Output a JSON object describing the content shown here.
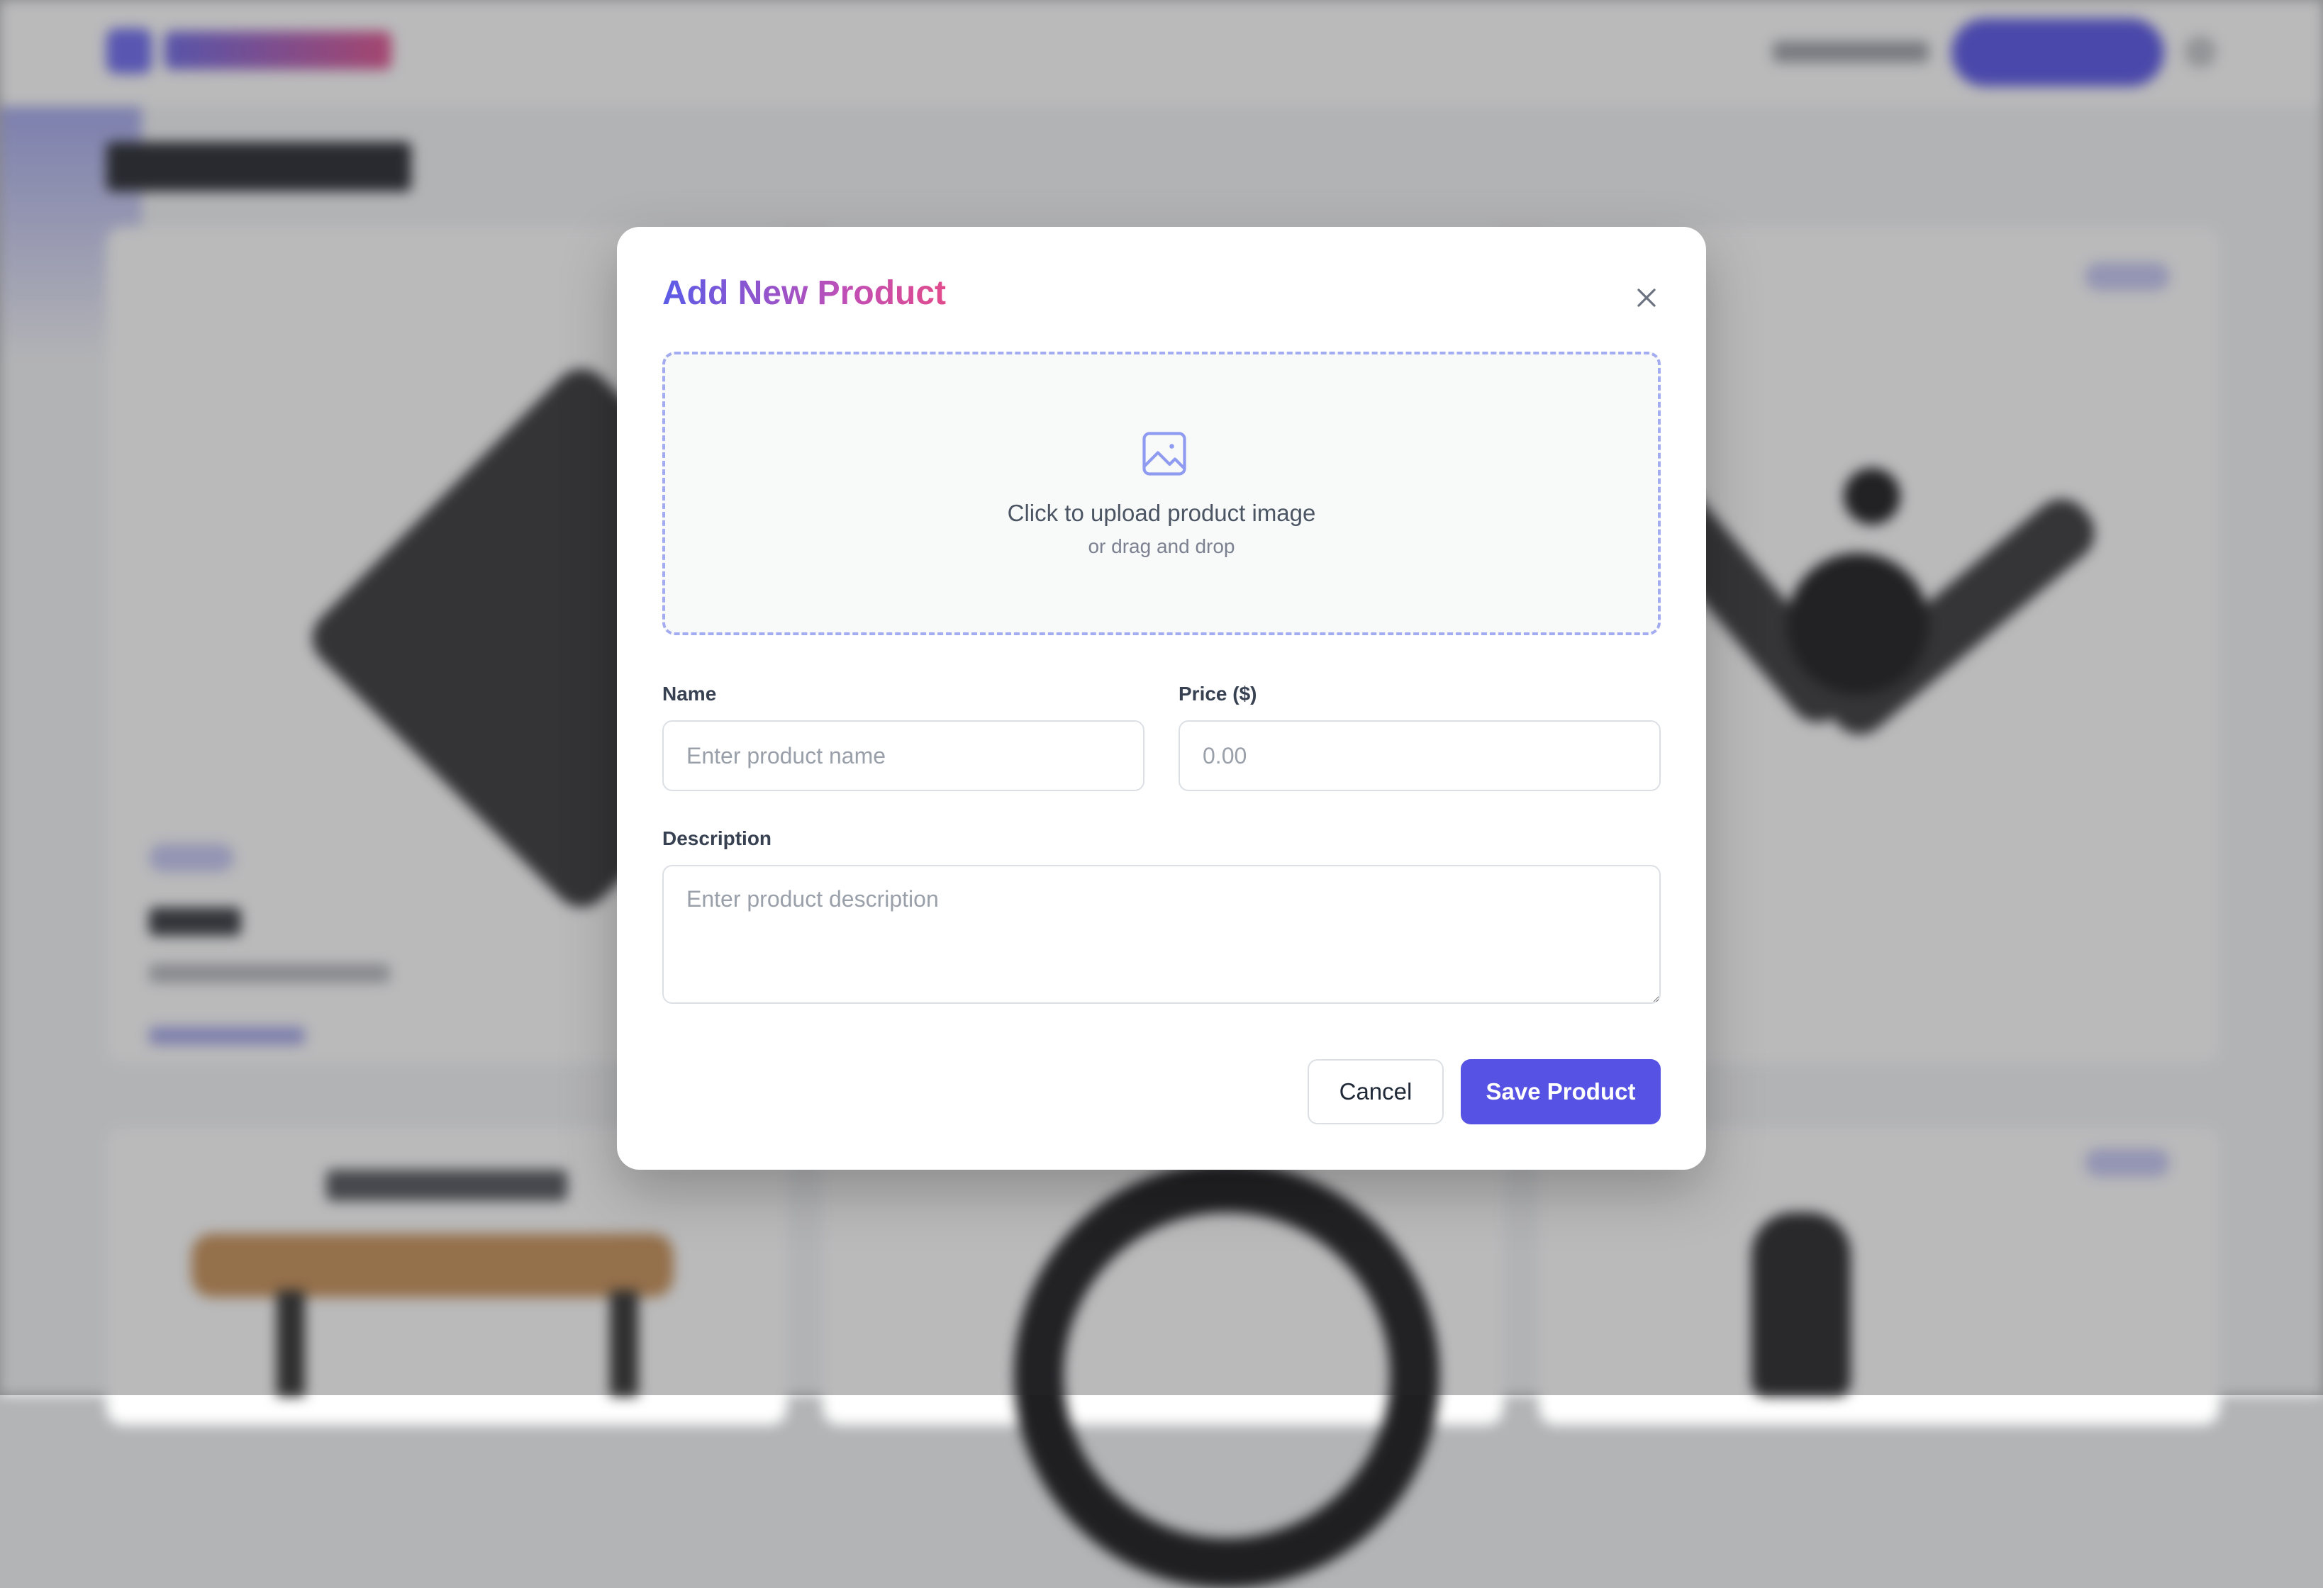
{
  "modal": {
    "title": "Add New Product",
    "close_icon": "close-icon",
    "upload": {
      "icon": "image-icon",
      "primary_text": "Click to upload product image",
      "secondary_text": "or drag and drop"
    },
    "fields": {
      "name": {
        "label": "Name",
        "placeholder": "Enter product name",
        "value": ""
      },
      "price": {
        "label": "Price ($)",
        "placeholder": "0.00",
        "value": ""
      },
      "description": {
        "label": "Description",
        "placeholder": "Enter product description",
        "value": ""
      }
    },
    "buttons": {
      "cancel_label": "Cancel",
      "save_label": "Save Product"
    }
  },
  "colors": {
    "accent": "#5652e3",
    "title_gradient_start": "#5b5ce8",
    "title_gradient_end": "#e14b8c",
    "upload_border": "#a3acf1",
    "overlay": "#b3b4b6"
  }
}
